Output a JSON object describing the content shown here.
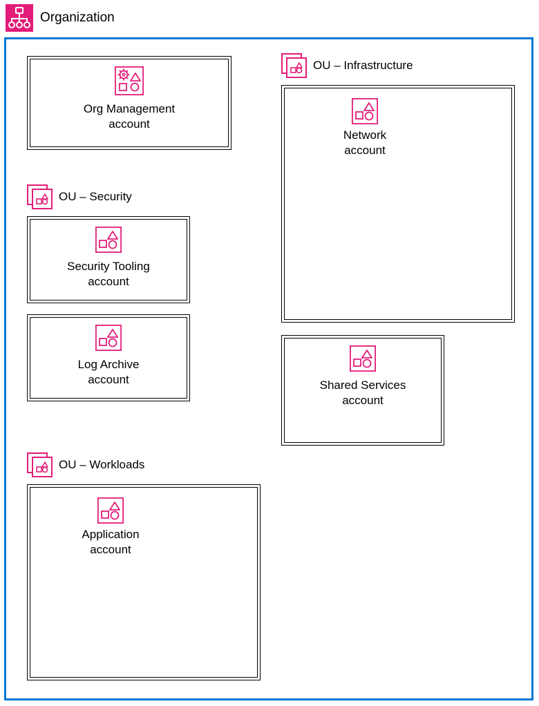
{
  "organization": {
    "title": "Organization"
  },
  "org_mgmt": {
    "line1": "Org Management",
    "line2": "account"
  },
  "ou_security": {
    "label": "OU – Security",
    "security_tooling": {
      "line1": "Security Tooling",
      "line2": "account"
    },
    "log_archive": {
      "line1": "Log Archive",
      "line2": "account"
    }
  },
  "ou_infrastructure": {
    "label": "OU – Infrastructure",
    "network": {
      "line1": "Network",
      "line2": "account"
    },
    "shared_services": {
      "line1": "Shared Services",
      "line2": "account"
    }
  },
  "ou_workloads": {
    "label": "OU – Workloads",
    "application": {
      "line1": "Application",
      "line2": "account"
    }
  },
  "colors": {
    "accent": "#e31c79",
    "border": "#0078d4"
  }
}
